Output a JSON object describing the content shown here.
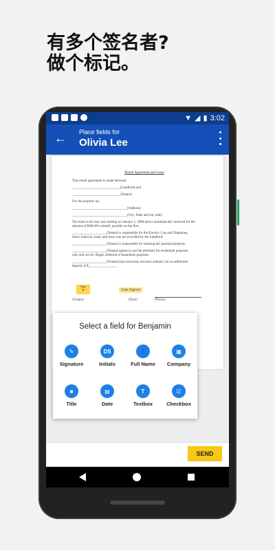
{
  "headline": {
    "line1": "有多个签名者?",
    "line2": "做个标记。"
  },
  "status_bar": {
    "time": "3:02"
  },
  "app_bar": {
    "subtitle": "Place fields for",
    "title": "Olivia Lee"
  },
  "document": {
    "title": "Rental Agreement and Lease",
    "lines": [
      "This rental agreement is made between:",
      "____________________________(Landlord) and",
      "____________________________(Tenant)",
      "For the property on:",
      "________________________________(Address)",
      "________________________________(City, State and zip code)",
      "The lease is for one year starting on January 1, 2009 and is automatically renewed for the",
      "amount of $400.00 a month, payable on the first.",
      "____________________(Tenant) is responsible for the Electric, Gas and Telephone,",
      "Snow removal, trash, and lawn care are provided by the Landlord.",
      "____________________(Tenant) is responsible for insuring her personal property.",
      "____________________(Tenant) agrees to use the premises for residential purposes",
      "only and not for illegal, immoral or hazardous purposes.",
      "____________________(Tenant) may have/may not have animals, for an additional",
      "deposit of $________________."
    ],
    "sign_tag": "Sign",
    "date_signed": "Date Signed",
    "sig_labels": {
      "tenant": "(Tenant)",
      "date": "(Date)",
      "phone": "(Phone)"
    }
  },
  "popup": {
    "title": "Select a field for Benjamin",
    "fields": [
      {
        "label": "Signature",
        "icon": "pen-icon",
        "glyph": "✎"
      },
      {
        "label": "Initials",
        "icon": "initials-icon",
        "glyph": "DS"
      },
      {
        "label": "Full Name",
        "icon": "person-icon",
        "glyph": "👤"
      },
      {
        "label": "Company",
        "icon": "building-icon",
        "glyph": "▦"
      },
      {
        "label": "Title",
        "icon": "briefcase-icon",
        "glyph": "■"
      },
      {
        "label": "Date",
        "icon": "calendar-icon",
        "glyph": "▤"
      },
      {
        "label": "Textbox",
        "icon": "text-icon",
        "glyph": "T"
      },
      {
        "label": "Checkbox",
        "icon": "checkbox-icon",
        "glyph": "☑"
      }
    ]
  },
  "send_label": "SEND",
  "colors": {
    "appbar": "#1550b8",
    "statusbar": "#0c3d8f",
    "accent": "#1e80e6",
    "send": "#f7c815"
  }
}
